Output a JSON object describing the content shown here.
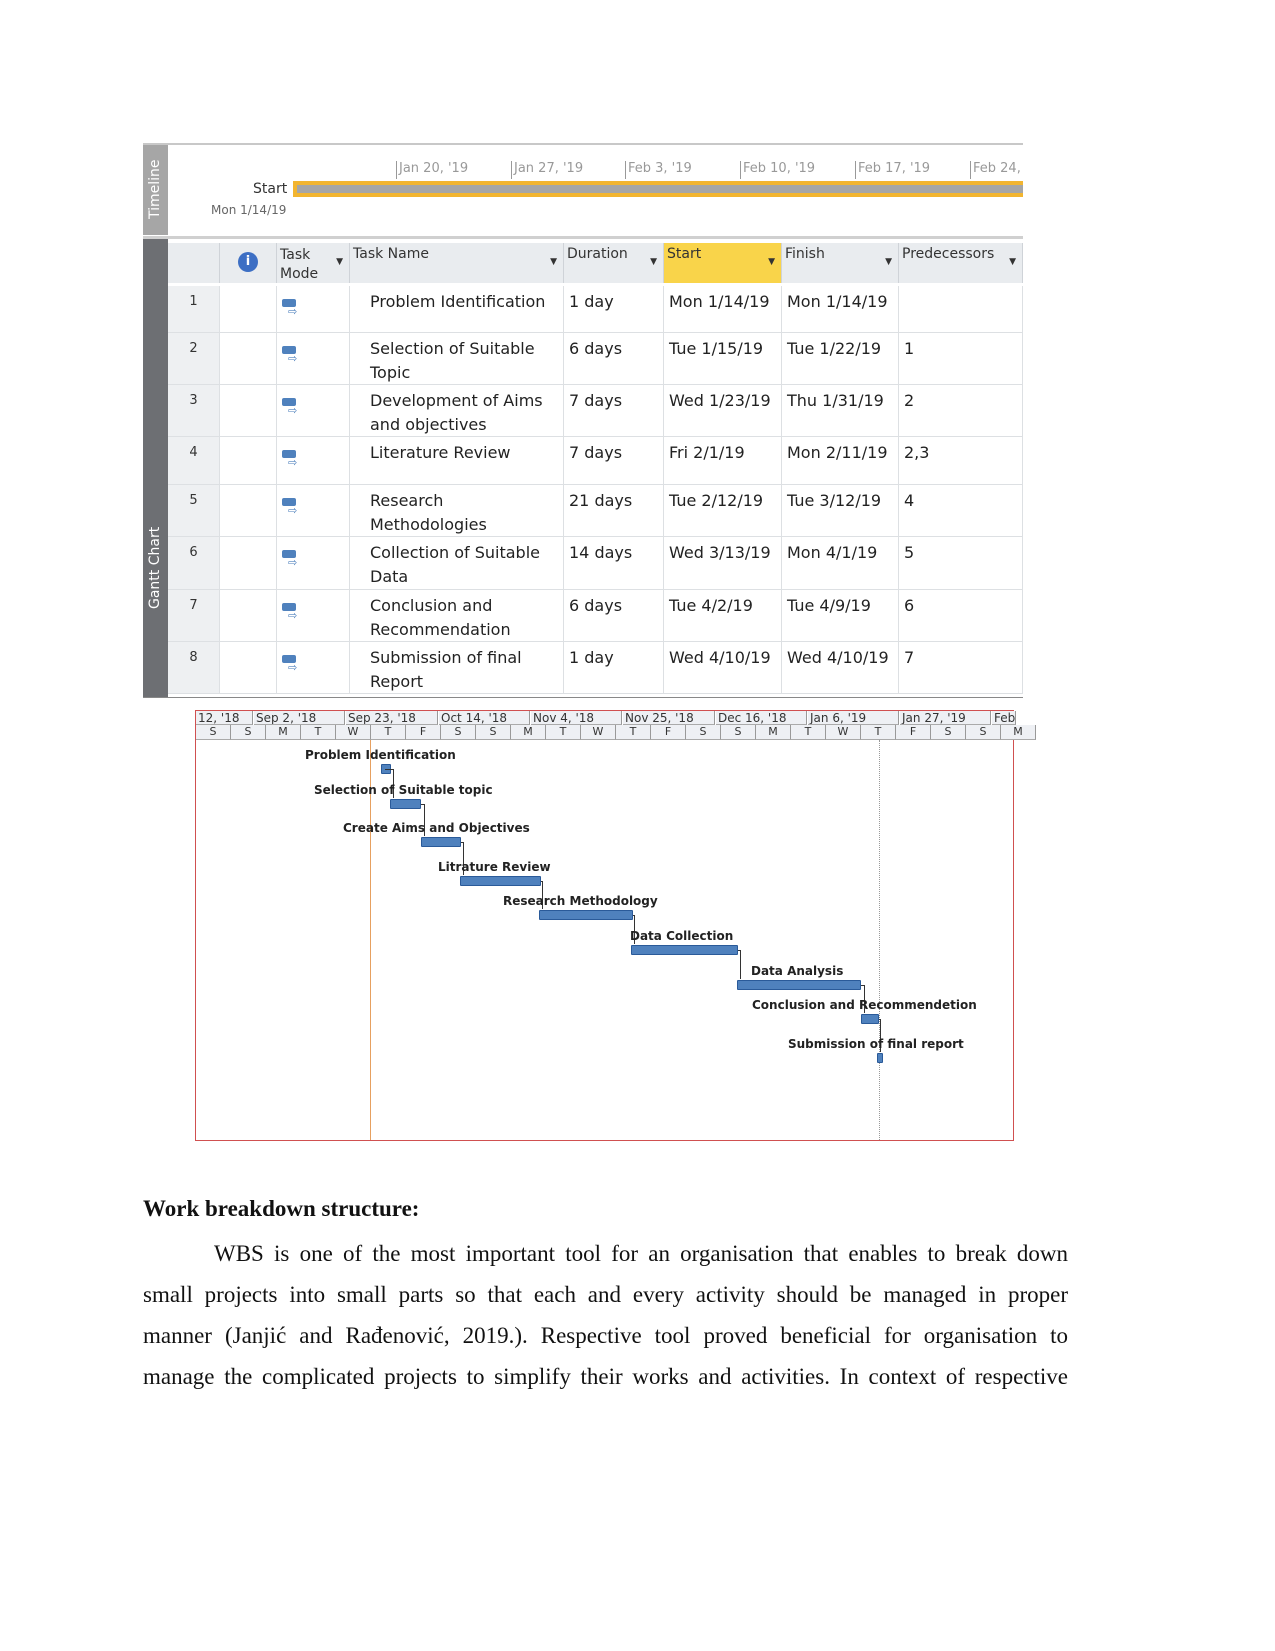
{
  "timeline": {
    "side_label": "Timeline",
    "start_label": "Start",
    "start_date": "Mon 1/14/19",
    "ticks": [
      "Jan 20, '19",
      "Jan 27, '19",
      "Feb 3, '19",
      "Feb 10, '19",
      "Feb 17, '19",
      "Feb 24,"
    ],
    "bar_color": "#f2b530"
  },
  "table": {
    "side_label": "Gantt Chart",
    "info_icon": "info-icon",
    "mode_icon": "auto-scheduled-task-icon",
    "headers": {
      "mode": "Task Mode",
      "name": "Task Name",
      "duration": "Duration",
      "start": "Start",
      "finish": "Finish",
      "predecessors": "Predecessors"
    },
    "rows": [
      {
        "id": "1",
        "name": "Problem Identification",
        "duration": "1 day",
        "start": "Mon 1/14/19",
        "finish": "Mon 1/14/19",
        "pred": ""
      },
      {
        "id": "2",
        "name": "Selection of Suitable Topic",
        "duration": "6 days",
        "start": "Tue 1/15/19",
        "finish": "Tue 1/22/19",
        "pred": "1"
      },
      {
        "id": "3",
        "name": "Development of Aims and objectives",
        "duration": "7 days",
        "start": "Wed 1/23/19",
        "finish": "Thu 1/31/19",
        "pred": "2"
      },
      {
        "id": "4",
        "name": "Literature Review",
        "duration": "7 days",
        "start": "Fri 2/1/19",
        "finish": "Mon 2/11/19",
        "pred": "2,3"
      },
      {
        "id": "5",
        "name": "Research Methodologies",
        "duration": "21 days",
        "start": "Tue 2/12/19",
        "finish": "Tue 3/12/19",
        "pred": "4"
      },
      {
        "id": "6",
        "name": "Collection of Suitable Data",
        "duration": "14 days",
        "start": "Wed 3/13/19",
        "finish": "Mon 4/1/19",
        "pred": "5"
      },
      {
        "id": "7",
        "name": "Conclusion and Recommendation",
        "duration": "6 days",
        "start": "Tue 4/2/19",
        "finish": "Tue 4/9/19",
        "pred": "6"
      },
      {
        "id": "8",
        "name": "Submission of final Report",
        "duration": "1 day",
        "start": "Wed 4/10/19",
        "finish": "Wed 4/10/19",
        "pred": "7"
      }
    ]
  },
  "gantt": {
    "periods": [
      "12, '18",
      "Sep 2, '18",
      "Sep 23, '18",
      "Oct 14, '18",
      "Nov 4, '18",
      "Nov 25, '18",
      "Dec 16, '18",
      "Jan 6, '19",
      "Jan 27, '19",
      "Feb"
    ],
    "days": [
      "S",
      "S",
      "M",
      "T",
      "W",
      "T",
      "F",
      "S",
      "S",
      "M",
      "T",
      "W",
      "T",
      "F",
      "S",
      "S",
      "M",
      "T",
      "W",
      "T",
      "F",
      "S",
      "S",
      "M"
    ],
    "tasks": [
      "Problem Identification",
      "Selection of Suitable topic",
      "Create Aims and Objectives",
      "Litrature Review",
      "Research Methodology",
      "Data Collection",
      "Data Analysis",
      "Conclusion and Recommendetion",
      "Submission of final report"
    ],
    "bar_color": "#4f81bd"
  },
  "document": {
    "heading": "Work breakdown structure:",
    "lines": [
      "WBS is one of the most important tool for an organisation that enables to break down",
      "small projects into small parts so that each and every activity should be managed in proper",
      "manner (Janjić  and Rađenović,  2019.). Respective tool proved beneficial for organisation to",
      "manage the complicated projects to simplify their works and activities. In context of respective"
    ]
  }
}
